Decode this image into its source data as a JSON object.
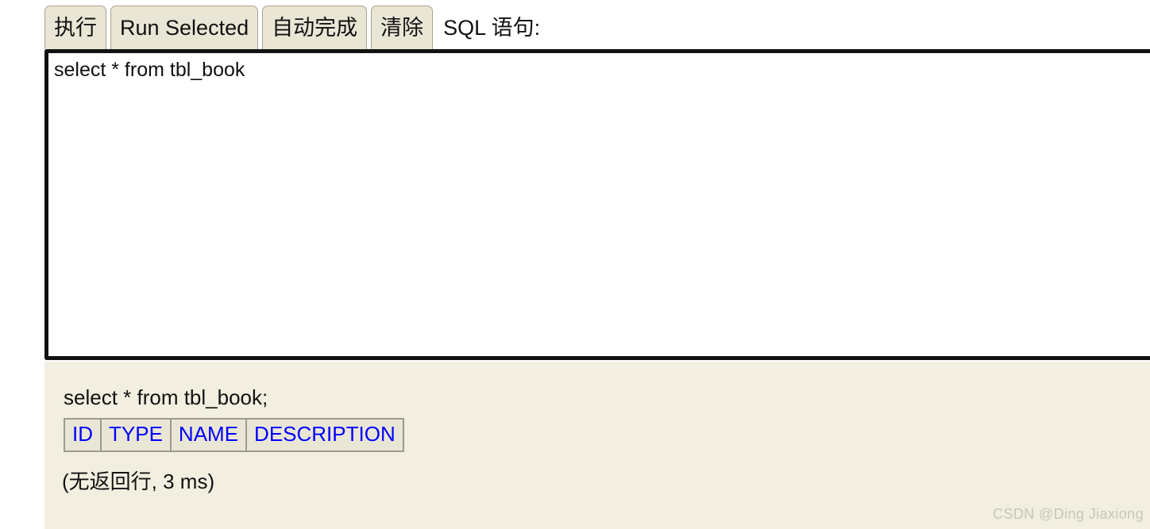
{
  "toolbar": {
    "buttons": [
      {
        "name": "execute",
        "label": "执行"
      },
      {
        "name": "run-selected",
        "label": "Run Selected"
      },
      {
        "name": "auto-complete",
        "label": "自动完成"
      },
      {
        "name": "clear",
        "label": "清除"
      }
    ],
    "sql_label": "SQL 语句:"
  },
  "editor": {
    "value": "select * from tbl_book",
    "placeholder": ""
  },
  "results": {
    "query_echo": "select * from tbl_book;",
    "table": {
      "headers": [
        "ID",
        "TYPE",
        "NAME",
        "DESCRIPTION"
      ],
      "rows": []
    },
    "status": "(无返回行, 3 ms)"
  },
  "watermark": {
    "text": "CSDN @Ding Jiaxiong"
  },
  "colors": {
    "page_background": "#ffffff",
    "button_background": "#eae6d6",
    "button_border": "#a9a48f",
    "editor_border": "#121212",
    "editor_background": "#ffffff",
    "results_background": "#f2efe0",
    "table_cell_background": "#eae6d6",
    "table_border": "#9c9a8c",
    "table_header_text": "#0000ff",
    "text": "#111111",
    "watermark_text": "#c8c6b8"
  }
}
